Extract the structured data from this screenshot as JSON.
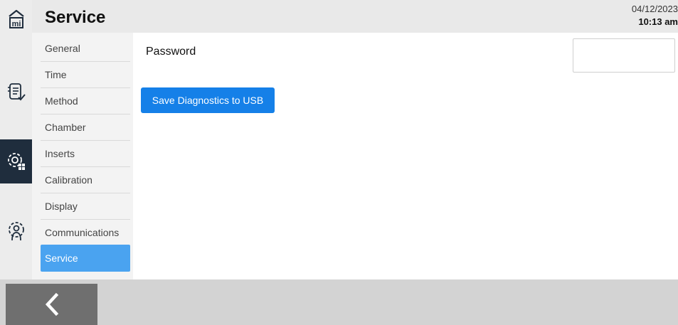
{
  "header": {
    "title": "Service",
    "date": "04/12/2023",
    "time": "10:13 am"
  },
  "rail": {
    "items": [
      {
        "icon": "home-icon"
      },
      {
        "icon": "method-list-icon"
      },
      {
        "icon": "instrument-settings-icon",
        "active": true
      },
      {
        "icon": "user-settings-icon"
      }
    ]
  },
  "submenu": {
    "items": [
      {
        "label": "General"
      },
      {
        "label": "Time"
      },
      {
        "label": "Method"
      },
      {
        "label": "Chamber"
      },
      {
        "label": "Inserts"
      },
      {
        "label": "Calibration"
      },
      {
        "label": "Display"
      },
      {
        "label": "Communications"
      },
      {
        "label": "Service",
        "active": true
      }
    ]
  },
  "main": {
    "password_label": "Password",
    "password_value": "",
    "save_button_label": "Save Diagnostics to USB"
  },
  "footer": {
    "back_icon": "chevron-left-icon"
  },
  "colors": {
    "accent": "#1580e8",
    "active_menu": "#4aa3f0",
    "active_rail": "#1f2d3d"
  }
}
